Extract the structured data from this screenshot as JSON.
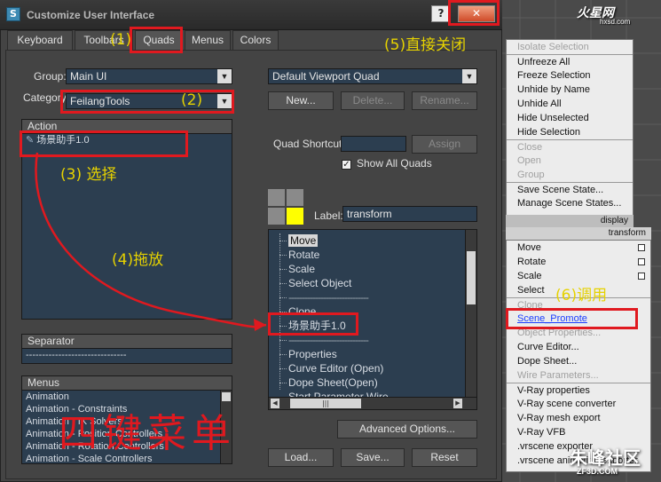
{
  "window": {
    "title": "Customize User Interface",
    "help_glyph": "?",
    "close_glyph": "✕",
    "app_icon_glyph": "S"
  },
  "tabs": [
    "Keyboard",
    "Toolbars",
    "Quads",
    "Menus",
    "Colors"
  ],
  "left": {
    "group_label": "Group:",
    "group_value": "Main UI",
    "category_label": "Category:",
    "category_value": "FeilangTools",
    "action_header": "Action",
    "action_item": "场景助手1.0",
    "separator_header": "Separator",
    "separator_item": "-------------------------------",
    "menus_header": "Menus",
    "menus_items": [
      "Animation",
      "Animation - Constraints",
      "Animation - IK Solvers",
      "Animation - Position Controllers",
      "Animation - Rotation Controllers",
      "Animation - Scale Controllers"
    ]
  },
  "right": {
    "quad_combo": "Default Viewport Quad",
    "new_btn": "New...",
    "delete_btn": "Delete...",
    "rename_btn": "Rename...",
    "shortcut_label": "Quad Shortcut:",
    "shortcut_value": "",
    "assign_btn": "Assign",
    "show_all_label": "Show All Quads",
    "show_all_checked": true,
    "label_label": "Label:",
    "label_value": "transform",
    "quad_color_active": "#ffff00",
    "tree_items": [
      "Move",
      "Rotate",
      "Scale",
      "Select Object",
      "------------------------------",
      "Clone",
      "场景助手1.0",
      "------------------------------",
      "Properties",
      "Curve Editor (Open)",
      "Dope Sheet(Open)",
      "Start Parameter Wire"
    ],
    "advanced_btn": "Advanced Options...",
    "load_btn": "Load...",
    "save_btn": "Save...",
    "reset_btn": "Reset"
  },
  "quad_menu": {
    "display_items": [
      {
        "label": "Isolate Selection",
        "disabled": true
      },
      {
        "label": "Unfreeze All",
        "disabled": false
      },
      {
        "label": "Freeze Selection",
        "disabled": false
      },
      {
        "label": "Unhide by Name",
        "disabled": false
      },
      {
        "label": "Unhide All",
        "disabled": false
      },
      {
        "label": "Hide Unselected",
        "disabled": false
      },
      {
        "label": "Hide Selection",
        "disabled": false
      },
      {
        "label": "Close",
        "disabled": true
      },
      {
        "label": "Open",
        "disabled": true
      },
      {
        "label": "Group",
        "disabled": true
      },
      {
        "label": "Save Scene State...",
        "disabled": false
      },
      {
        "label": "Manage Scene States...",
        "disabled": false
      }
    ],
    "display_header": "display",
    "transform_header": "transform",
    "transform_items": [
      {
        "label": "Move",
        "disabled": false
      },
      {
        "label": "Rotate",
        "disabled": false
      },
      {
        "label": "Scale",
        "disabled": false
      },
      {
        "label": "Select",
        "disabled": false
      },
      {
        "label": "Clone",
        "disabled": true
      },
      {
        "label": "Scene_Promote",
        "disabled": false
      },
      {
        "label": "Object Properties...",
        "disabled": true
      },
      {
        "label": "Curve Editor...",
        "disabled": false
      },
      {
        "label": "Dope Sheet...",
        "disabled": false
      },
      {
        "label": "Wire Parameters...",
        "disabled": true
      },
      {
        "label": "V-Ray properties",
        "disabled": false
      },
      {
        "label": "V-Ray scene converter",
        "disabled": false
      },
      {
        "label": "V-Ray mesh export",
        "disabled": false
      },
      {
        "label": "V-Ray VFB",
        "disabled": false
      },
      {
        "label": ".vrscene exporter",
        "disabled": false
      },
      {
        "label": ".vrscene animation exporter",
        "disabled": false
      }
    ]
  },
  "annotations": {
    "step1": "(1)",
    "step2": "(2)",
    "step3": "(3) 选择",
    "step4": "(4)拖放",
    "step5": "(5)直接关闭",
    "step6": "(6)调用",
    "big": "四键菜单"
  },
  "watermarks": {
    "top": "火星网",
    "top_sub": "hxsd.com",
    "bottom": "朱峰社区",
    "bottom_sub": "ZF3D.COM"
  }
}
